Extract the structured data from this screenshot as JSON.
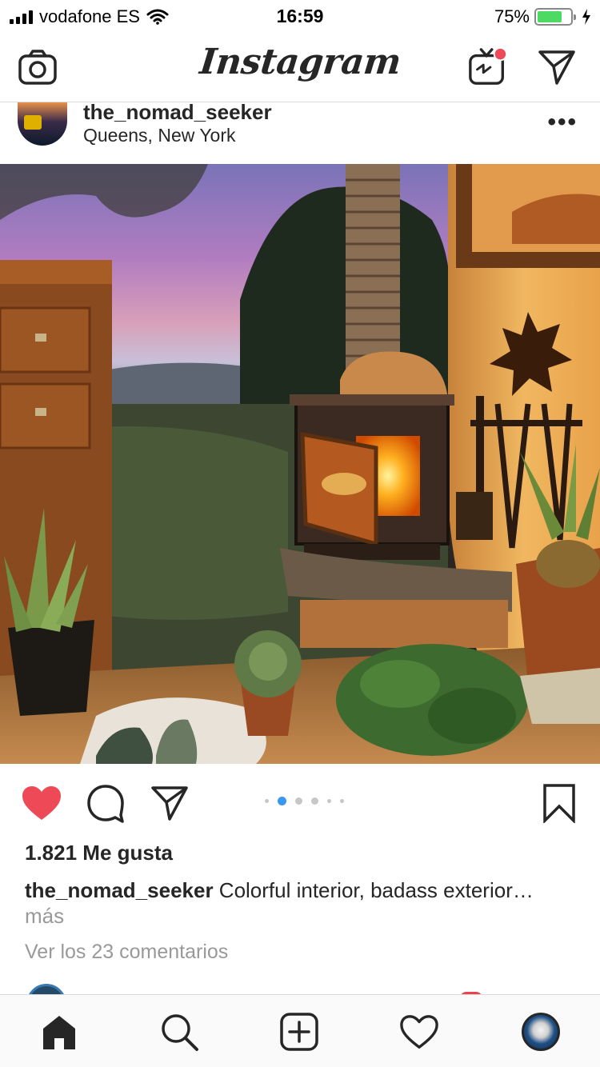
{
  "status_bar": {
    "carrier": "vodafone ES",
    "time": "16:59",
    "battery_percent": "75%",
    "battery_level": 0.75,
    "icons": [
      "signal-icon",
      "wifi-icon",
      "battery-icon",
      "charging-bolt-icon"
    ]
  },
  "header": {
    "logo_text": "Instagram",
    "icons": [
      "camera-icon",
      "igtv-icon",
      "direct-message-icon"
    ],
    "igtv_notification_color": "#ed4956"
  },
  "post": {
    "username": "the_nomad_seeker",
    "location": "Queens, New York",
    "more_icon": "ellipsis-icon",
    "photo_description_icon": "post-photo",
    "carousel": {
      "total_dots": 6,
      "active_index": 1
    },
    "like_state": "liked",
    "like_color": "#ed4956",
    "likes_text": "1.821 Me gusta",
    "caption_username": "the_nomad_seeker",
    "caption_text": " Colorful interior, badass exterior…",
    "caption_more": " más",
    "comments_link": "Ver los 23 comentarios"
  },
  "tab_bar": {
    "items": [
      "home-icon",
      "search-icon",
      "new-post-icon",
      "activity-icon",
      "profile-icon"
    ],
    "active": "home-icon"
  },
  "colors": {
    "text_primary": "#262626",
    "text_secondary": "#999999",
    "accent_blue": "#3897f0",
    "divider": "#dbdbdb"
  }
}
